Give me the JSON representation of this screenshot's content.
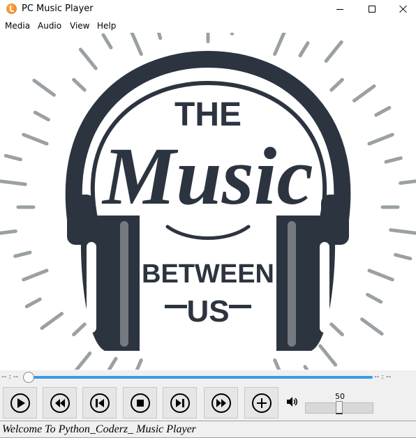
{
  "window": {
    "title": "PC Music Player"
  },
  "menu": {
    "items": [
      "Media",
      "Audio",
      "View",
      "Help"
    ]
  },
  "artwork": {
    "line1": "THE",
    "line2": "Music",
    "line3": "BETWEEN",
    "line4": "US",
    "ink_color": "#2c3440",
    "ray_color": "#9aa0a3"
  },
  "seek": {
    "elapsed": "-- : --",
    "remaining": "-- : --",
    "progress": 0,
    "accent": "#3c9be4"
  },
  "controls": {
    "buttons": [
      "play-icon",
      "rewind-icon",
      "previous-icon",
      "stop-icon",
      "next-icon",
      "fast-forward-icon",
      "add-icon"
    ]
  },
  "volume": {
    "value": "50",
    "level": 0.5,
    "icon": "speaker-icon"
  },
  "status": {
    "text": "Welcome To Python_Coderz_ Music Player"
  }
}
